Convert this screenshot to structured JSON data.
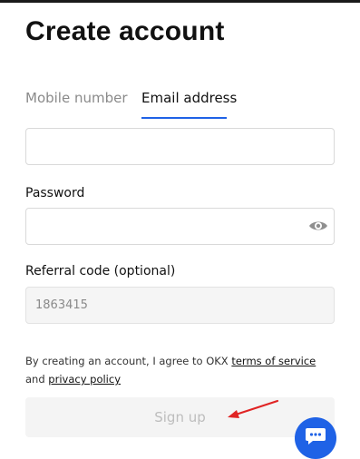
{
  "page": {
    "title": "Create account"
  },
  "tabs": [
    {
      "label": "Mobile number",
      "active": false
    },
    {
      "label": "Email address",
      "active": true
    }
  ],
  "form": {
    "email": {
      "value": "",
      "placeholder": ""
    },
    "password": {
      "label": "Password",
      "value": "",
      "placeholder": ""
    },
    "referral": {
      "label": "Referral code (optional)",
      "value": "1863415"
    }
  },
  "terms": {
    "prefix": "By creating an account, I agree to OKX ",
    "terms_link": "terms of service",
    "middle": " and ",
    "privacy_link": "privacy policy"
  },
  "signup": {
    "label": "Sign up",
    "enabled": false
  },
  "icons": {
    "password_toggle": "eye-icon",
    "chat": "chat-icon"
  },
  "colors": {
    "accent": "#1f62e6",
    "annotation_arrow": "#e02424"
  }
}
